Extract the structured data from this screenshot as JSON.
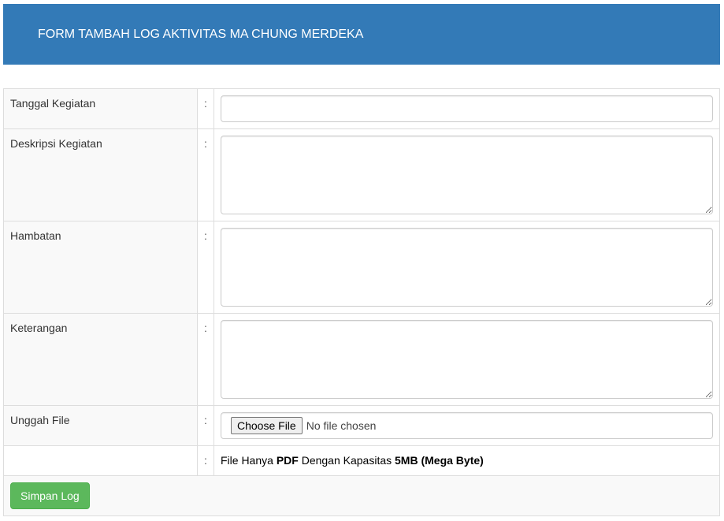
{
  "header": {
    "title": "FORM TAMBAH LOG AKTIVITAS MA CHUNG MERDEKA"
  },
  "form": {
    "colon": ":",
    "fields": {
      "tanggal": {
        "label": "Tanggal Kegiatan",
        "value": ""
      },
      "deskripsi": {
        "label": "Deskripsi Kegiatan",
        "value": ""
      },
      "hambatan": {
        "label": "Hambatan",
        "value": ""
      },
      "keterangan": {
        "label": "Keterangan",
        "value": ""
      },
      "unggah": {
        "label": "Unggah File",
        "button_label": "Choose File",
        "status": "No file chosen"
      }
    },
    "note": {
      "prefix": "File Hanya ",
      "format": "PDF",
      "middle": " Dengan Kapasitas ",
      "size": "5MB (Mega Byte)"
    },
    "submit_label": "Simpan Log"
  },
  "colors": {
    "header_bg": "#337ab7",
    "submit_bg": "#5cb85c"
  }
}
